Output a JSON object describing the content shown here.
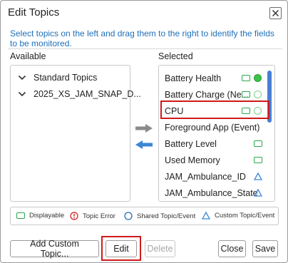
{
  "dialog": {
    "title": "Edit Topics",
    "instructions": "Select topics on the left and drag them to the right to identify the fields to be monitored."
  },
  "available": {
    "label": "Available",
    "nodes": [
      {
        "label": "Standard Topics",
        "icon": "chevron-down-icon"
      },
      {
        "label": "2025_XS_JAM_SNAP_D...",
        "icon": "chevron-down-icon"
      }
    ]
  },
  "selected": {
    "label": "Selected",
    "items": [
      {
        "label": "Battery Health",
        "badges": [
          "displayable",
          "shared-filled"
        ]
      },
      {
        "label": "Battery Charge (Ne...",
        "badges": [
          "displayable",
          "shared-empty"
        ]
      },
      {
        "label": "CPU",
        "badges": [
          "displayable",
          "shared-empty"
        ]
      },
      {
        "label": "Foreground App (Event)",
        "badges": []
      },
      {
        "label": "Battery Level",
        "badges": [
          "displayable"
        ]
      },
      {
        "label": "Used Memory",
        "badges": [
          "displayable"
        ]
      },
      {
        "label": "JAM_Ambulance_ID",
        "badges": [
          "custom"
        ]
      },
      {
        "label": "JAM_Ambulance_State",
        "badges": [
          "custom"
        ]
      }
    ]
  },
  "legend": {
    "displayable": "Displayable",
    "topic_error": "Topic Error",
    "shared": "Shared Topic/Event",
    "custom": "Custom Topic/Event"
  },
  "buttons": {
    "add_custom": "Add Custom Topic...",
    "edit": "Edit",
    "delete": "Delete",
    "close": "Close",
    "save": "Save"
  },
  "colors": {
    "accent_blue": "#1f6fb8",
    "arrow_gray": "#8a8a8a",
    "arrow_blue": "#3b86d6",
    "displayable_green": "#2aa84a",
    "highlight_red": "#d01a1a",
    "scroll_blue": "#4a7fd4"
  }
}
